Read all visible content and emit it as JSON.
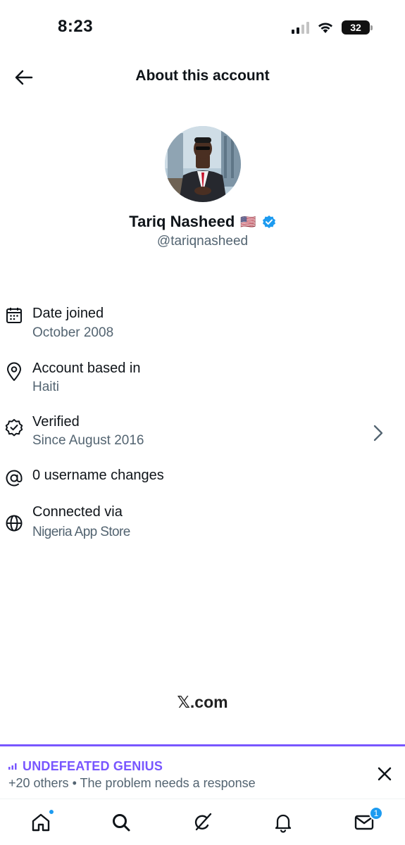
{
  "status_bar": {
    "time": "8:23",
    "battery": "32"
  },
  "header": {
    "back_icon": "arrow-left-icon",
    "title": "About this account"
  },
  "profile": {
    "display_name": "Tariq Nasheed",
    "flag": "🇺🇸",
    "verified_icon": "verified-badge-icon",
    "handle": "@tariqnasheed"
  },
  "info_rows": [
    {
      "icon": "calendar-icon",
      "label": "Date joined",
      "value": "October 2008"
    },
    {
      "icon": "location-pin-icon",
      "label": "Account based in",
      "value": "Haiti"
    },
    {
      "icon": "verified-outline-icon",
      "label": "Verified",
      "value": "Since August 2016"
    },
    {
      "icon": "at-sign-icon",
      "label": "0 username changes",
      "value": ""
    },
    {
      "icon": "globe-icon",
      "label": "Connected via",
      "value": "Nigeria App Store"
    }
  ],
  "brand": "𝕏.com",
  "spaces_bar": {
    "title": "UNDEFEATED GENIUS",
    "subtitle": "+20 others • The problem needs a response",
    "accent": "#7856ff"
  },
  "tab_bar": {
    "tabs": [
      "home-icon",
      "search-icon",
      "grok-icon",
      "notifications-icon",
      "messages-icon"
    ],
    "messages_badge": "1"
  },
  "colors": {
    "accent": "#1d9bf0",
    "text": "#0f1419",
    "secondary": "#536471"
  }
}
